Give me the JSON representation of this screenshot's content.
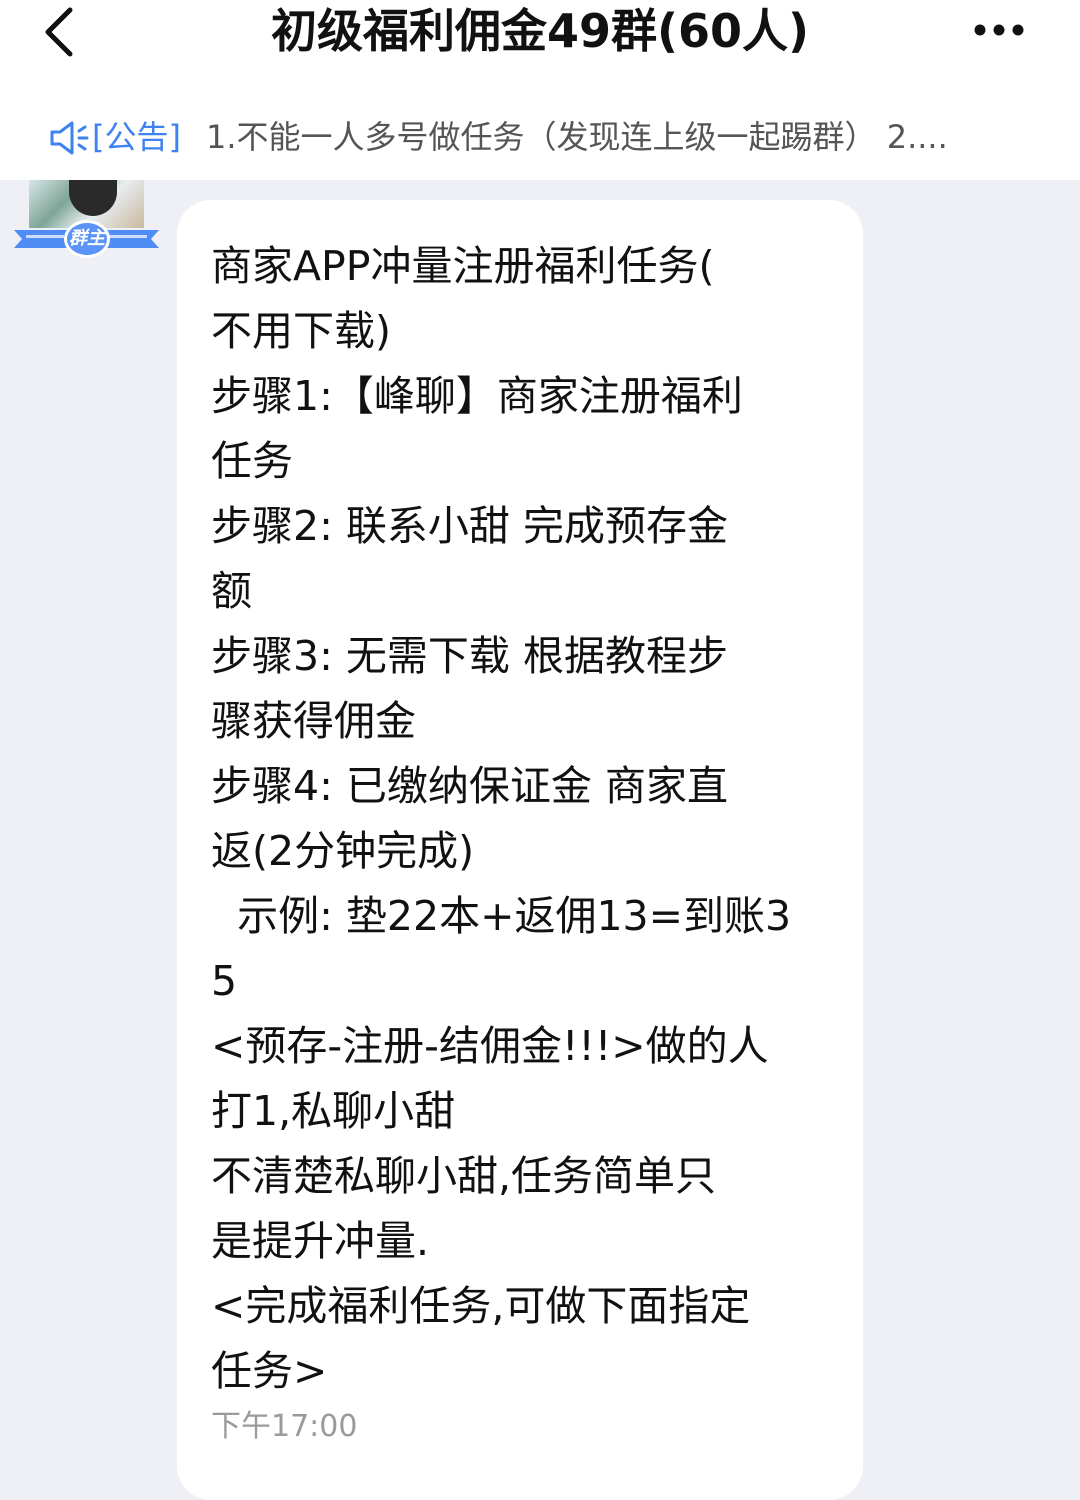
{
  "header": {
    "title": "初级福利佣金49群(60人)"
  },
  "notice": {
    "tag": "[公告]",
    "text": "1.不能一人多号做任务（发现连上级一起踢群） 2...."
  },
  "sender": {
    "badge": "群主"
  },
  "message": {
    "text": "商家APP冲量注册福利任务(\n不用下载)\n步骤1:【峰聊】商家注册福利\n任务\n步骤2: 联系小甜 完成预存金\n额\n步骤3: 无需下载 根据教程步\n骤获得佣金\n步骤4: 已缴纳保证金 商家直\n返(2分钟完成)\n  示例: 垫22本+返佣13=到账3\n5\n<预存-注册-结佣金!!!>做的人\n打1,私聊小甜\n不清楚私聊小甜,任务简单只\n是提升冲量.\n<完成福利任务,可做下面指定\n任务>",
    "time": "下午17:00"
  },
  "icons": {
    "back": "chevron-left-icon",
    "more": "more-horizontal-icon",
    "notice": "megaphone-icon"
  },
  "colors": {
    "accent": "#3d82f0",
    "background": "#eef0f5",
    "bubble": "#ffffff"
  }
}
